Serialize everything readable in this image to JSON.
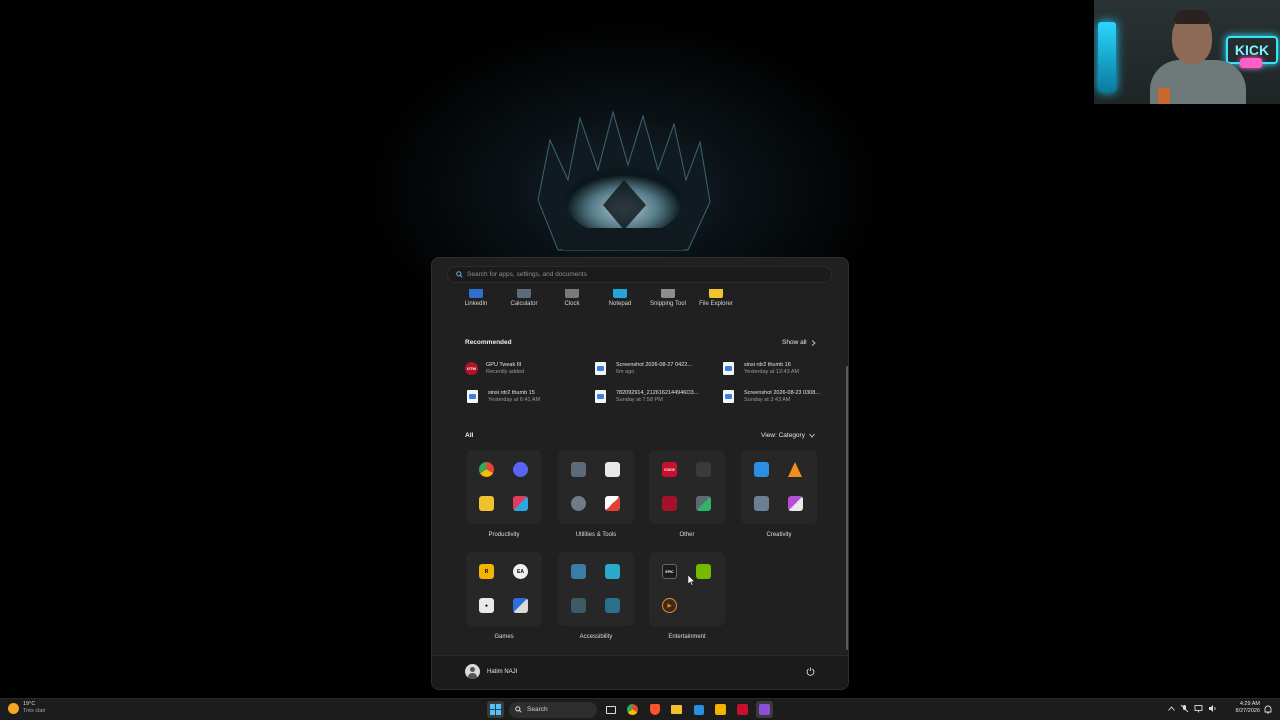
{
  "start_menu": {
    "search_placeholder": "Search for apps, settings, and documents",
    "pinned": [
      {
        "label": "LinkedIn",
        "icon": "linkedin-icon",
        "color": "#2f6fd0"
      },
      {
        "label": "Calculator",
        "icon": "calculator-icon",
        "color": "#5c6b7a"
      },
      {
        "label": "Clock",
        "icon": "clock-icon",
        "color": "#7a7a7a"
      },
      {
        "label": "Notepad",
        "icon": "notepad-icon",
        "color": "#25a3d9"
      },
      {
        "label": "Snipping Tool",
        "icon": "snipping-tool-icon",
        "color": "#8d8d8d"
      },
      {
        "label": "File Explorer",
        "icon": "file-explorer-icon",
        "color": "#f2c12e"
      }
    ],
    "recommended": {
      "title": "Recommended",
      "show_all": "Show all",
      "items": [
        {
          "name": "GPU Tweak III",
          "detail": "Recently added",
          "icon": "gpu-tweak-icon"
        },
        {
          "name": "Screenshot 2026-08-27 0422...",
          "detail": "6m ago",
          "icon": "image-file-icon"
        },
        {
          "name": "sinsi rdr2 thumb 16",
          "detail": "Yesterday at 12:43 AM",
          "icon": "image-file-icon"
        },
        {
          "name": "sinsi rdr2 thumb 15",
          "detail": "Yesterday at 6:41 AM",
          "icon": "image-file-icon"
        },
        {
          "name": "782092914_2126162144946O3...",
          "detail": "Sunday at 7:58 PM",
          "icon": "image-file-icon"
        },
        {
          "name": "Screenshot 2026-08-23 0308...",
          "detail": "Sunday at 3:43 AM",
          "icon": "image-file-icon"
        }
      ]
    },
    "all": {
      "title": "All",
      "view": "View: Category",
      "categories": [
        {
          "label": "Productivity"
        },
        {
          "label": "Utilities & Tools"
        },
        {
          "label": "Other"
        },
        {
          "label": "Creativity"
        },
        {
          "label": "Games"
        },
        {
          "label": "Accessibility"
        },
        {
          "label": "Entertainment"
        }
      ]
    },
    "user_name": "Hatim NAJI"
  },
  "webcam": {
    "sign_text": "KICK"
  },
  "taskbar": {
    "weather_temp": "19°C",
    "weather_desc": "Très clair",
    "search_label": "Search",
    "time": "4:29 AM",
    "date": "8/27/2026"
  },
  "colors": {
    "accent": "#0078d4",
    "panel": "#202020",
    "taskbar": "#1c1c1c"
  }
}
